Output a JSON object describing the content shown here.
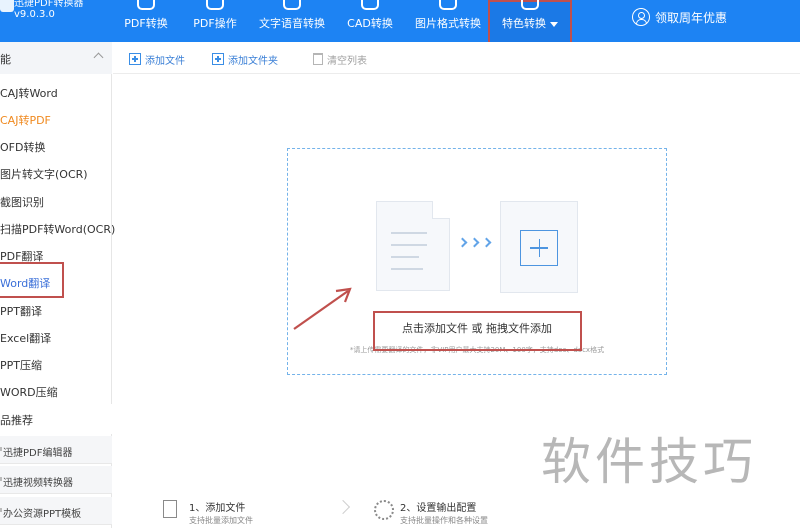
{
  "app": {
    "name": "迅捷PDF转换器",
    "version": "v9.0.3.0"
  },
  "nav": {
    "items": [
      {
        "label": "PDF转换"
      },
      {
        "label": "PDF操作"
      },
      {
        "label": "文字语音转换"
      },
      {
        "label": "CAD转换"
      },
      {
        "label": "图片格式转换"
      },
      {
        "label": "特色转换"
      }
    ],
    "promo": "领取周年优惠"
  },
  "sidebar": {
    "section_title": "能",
    "items": [
      {
        "label": "CAJ转Word"
      },
      {
        "label": "CAJ转PDF"
      },
      {
        "label": "OFD转换"
      },
      {
        "label": "图片转文字(OCR)"
      },
      {
        "label": "截图识别"
      },
      {
        "label": "扫描PDF转Word(OCR)"
      },
      {
        "label": "PDF翻译"
      },
      {
        "label": "Word翻译"
      },
      {
        "label": "PPT翻译"
      },
      {
        "label": "Excel翻译"
      },
      {
        "label": "PPT压缩"
      },
      {
        "label": "WORD压缩"
      }
    ],
    "products_title": "品推荐",
    "products": [
      {
        "label": "迅捷PDF编辑器"
      },
      {
        "label": "迅捷视频转换器"
      },
      {
        "label": "办公资源PPT模板"
      }
    ]
  },
  "toolbar": {
    "add_file": "添加文件",
    "add_folder": "添加文件夹",
    "clear_list": "清空列表"
  },
  "dropzone": {
    "title": "点击添加文件 或 拖拽文件添加",
    "hint": "*请上传需要翻译的文件，非VIP用户最大支持20M、100字，支持doc、docx格式"
  },
  "steps": [
    {
      "title": "1、添加文件",
      "desc": "支持批量添加文件"
    },
    {
      "title": "2、设置输出配置",
      "desc": "支持批量操作和各种设置"
    }
  ],
  "watermark": "软件技巧",
  "colors": {
    "topbar": "#1d83f3",
    "active_item": "#f08a20",
    "highlight_box": "#c0504d",
    "dashed_border": "#74b3ea"
  }
}
